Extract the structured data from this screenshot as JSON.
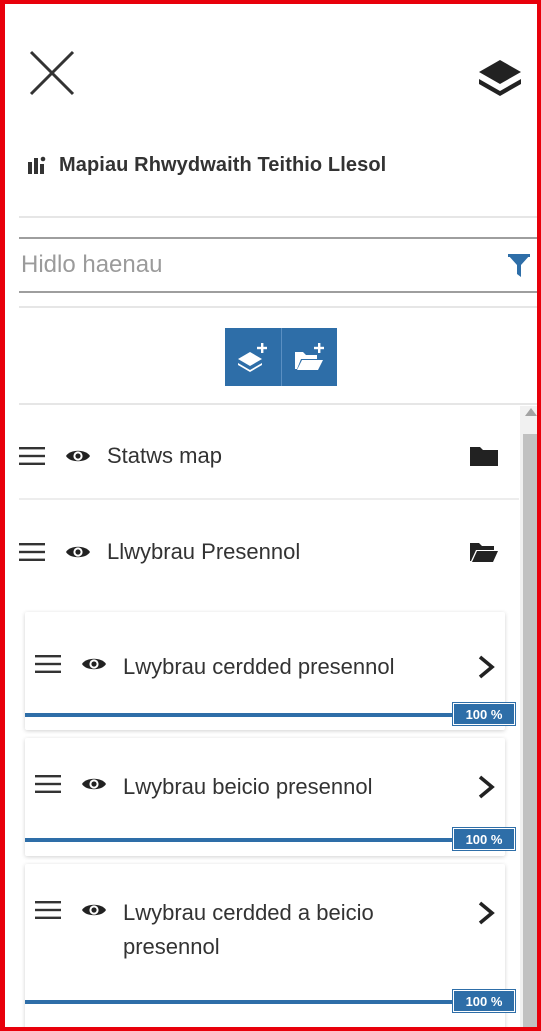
{
  "panel": {
    "title": "Mapiau Rhwydwaith Teithio Llesol",
    "close_icon": "close-icon",
    "layers_icon": "layers-icon",
    "title_icon": "map-legend-icon"
  },
  "filter": {
    "placeholder": "Hidlo haenau",
    "value": "",
    "icon": "filter-icon"
  },
  "toolbar": {
    "buttons": [
      {
        "name": "add-layer-button",
        "icon": "add-layer-icon"
      },
      {
        "name": "add-group-button",
        "icon": "add-folder-icon"
      }
    ]
  },
  "layers": [
    {
      "label": "Statws map",
      "visible": true,
      "type": "group-closed",
      "icon": "folder-icon"
    },
    {
      "label": "Llwybrau Presennol",
      "visible": true,
      "type": "group-open",
      "icon": "folder-open-icon",
      "children": [
        {
          "label": "Lwybrau cerdded presennol",
          "visible": true,
          "opacity": "100 %",
          "opacity_value": 100
        },
        {
          "label": "Lwybrau beicio presennol",
          "visible": true,
          "opacity": "100 %",
          "opacity_value": 100
        },
        {
          "label": "Lwybrau cerdded a beicio presennol",
          "visible": true,
          "opacity": "100 %",
          "opacity_value": 100
        }
      ]
    }
  ],
  "colors": {
    "accent": "#2e6ea8",
    "frame": "#e8000b",
    "text": "#333333"
  }
}
